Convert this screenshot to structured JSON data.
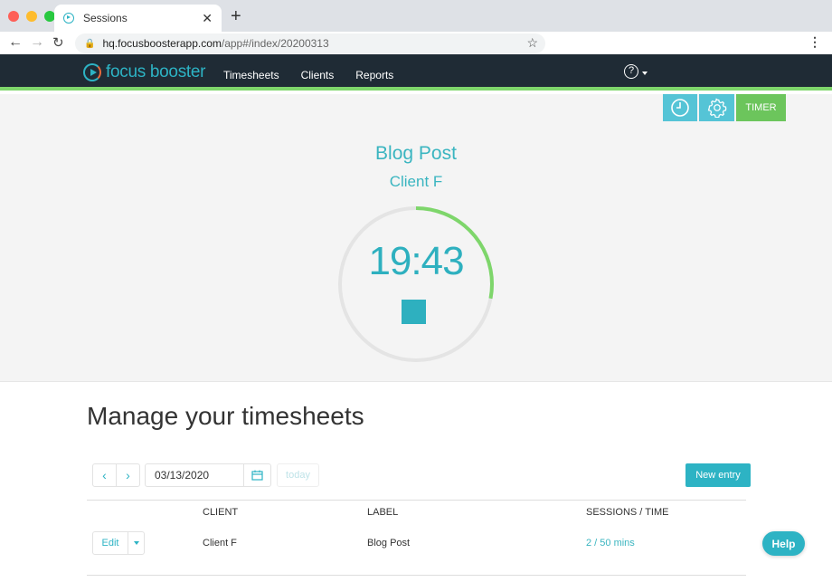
{
  "browser": {
    "tab_title": "Sessions",
    "url_host": "hq.focusboosterapp.com",
    "url_path": "/app#/index/20200313"
  },
  "app": {
    "brand": "focus booster",
    "nav": [
      "Timesheets",
      "Clients",
      "Reports"
    ],
    "help_icon": "?"
  },
  "timer": {
    "mode_buttons": {
      "clock": "clock-icon",
      "settings": "gear-icon",
      "timer_label": "TIMER"
    },
    "task_label": "Blog Post",
    "client": "Client F",
    "time_remaining": "19:43",
    "progress_fraction": 0.28,
    "colors": {
      "accent": "#2eb0bf",
      "progress": "#7ed66b",
      "track": "#e4e4e4"
    }
  },
  "timesheets": {
    "heading": "Manage your timesheets",
    "date_value": "03/13/2020",
    "today_label": "today",
    "new_entry_label": "New entry",
    "columns": [
      "CLIENT",
      "LABEL",
      "SESSIONS / TIME"
    ],
    "rows": [
      {
        "edit_label": "Edit",
        "client": "Client F",
        "label": "Blog Post",
        "sessions_time": "2 / 50 mins"
      }
    ]
  },
  "help_button": "Help"
}
